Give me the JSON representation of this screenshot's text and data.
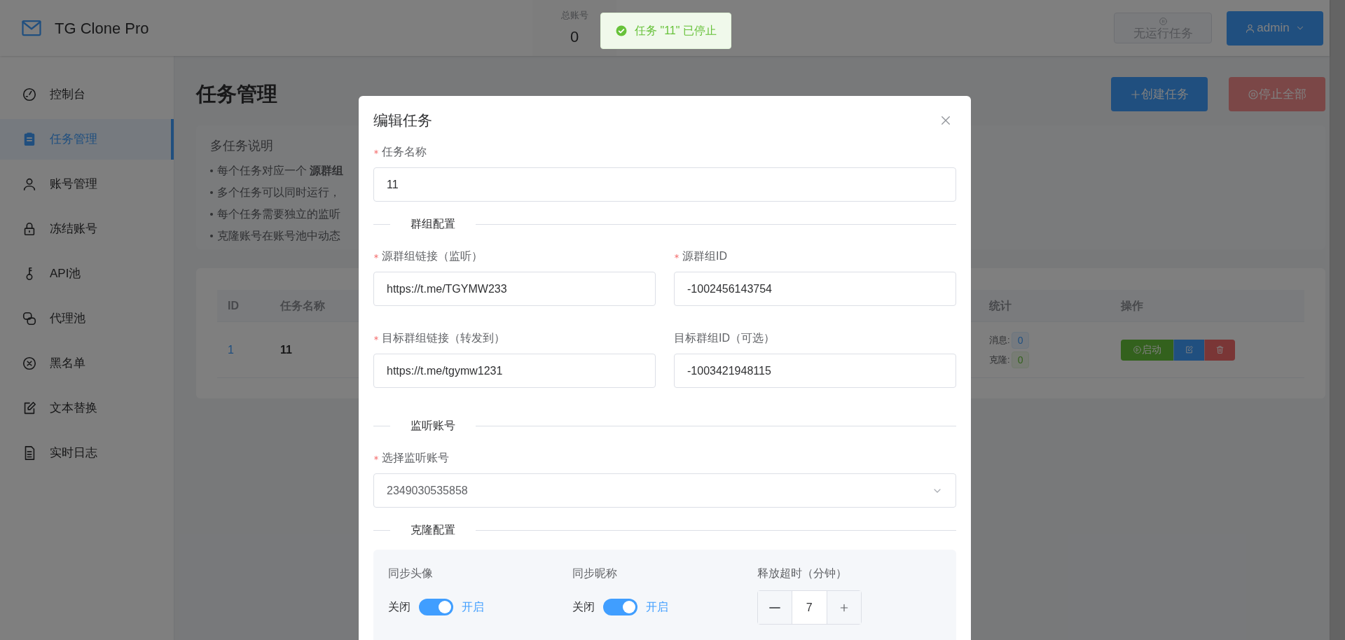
{
  "app": {
    "title": "TG Clone Pro"
  },
  "header_stats": [
    {
      "label": "总账号",
      "value": "0"
    }
  ],
  "toast": {
    "kind": "success",
    "message": "任务 \"11\" 已停止"
  },
  "header_actions": {
    "status_button": "无运行任务",
    "user_menu": "admin"
  },
  "sidebar": {
    "items": [
      {
        "label": "控制台",
        "selected": false
      },
      {
        "label": "任务管理",
        "selected": true
      },
      {
        "label": "账号管理",
        "selected": false
      },
      {
        "label": "冻结账号",
        "selected": false
      },
      {
        "label": "API池",
        "selected": false
      },
      {
        "label": "代理池",
        "selected": false
      },
      {
        "label": "黑名单",
        "selected": false
      },
      {
        "label": "文本替换",
        "selected": false
      },
      {
        "label": "实时日志",
        "selected": false
      }
    ]
  },
  "page": {
    "title": "任务管理",
    "buttons": [
      {
        "label": "创建任务",
        "kind": "create",
        "disabled": false
      },
      {
        "label": "停止全部",
        "kind": "stop",
        "disabled": true
      }
    ]
  },
  "info": {
    "title": "多任务说明",
    "lines": [
      "每个任务对应一个 **源群组**",
      "多个任务可以同时运行，",
      "每个任务需要独立的监听",
      "克隆账号在账号池中动态"
    ]
  },
  "table": {
    "columns": [
      {
        "label": "ID",
        "kind": "id"
      },
      {
        "label": "任务名称",
        "kind": "name"
      },
      {
        "label": "统计",
        "kind": "stats"
      },
      {
        "label": "操作",
        "kind": "actions"
      }
    ],
    "rows": [
      {
        "id": "1",
        "name": "11",
        "stats": [
          {
            "label": "消息:",
            "value": "0",
            "kind": "info"
          },
          {
            "label": "克隆:",
            "value": "0",
            "kind": "success"
          }
        ],
        "actions": [
          {
            "kind": "start",
            "label": "启动"
          },
          {
            "kind": "edit"
          },
          {
            "kind": "delete"
          }
        ]
      }
    ]
  },
  "dialog": {
    "title": "编辑任务",
    "name_field": {
      "label": "任务名称",
      "required": true,
      "value": "11"
    },
    "groups": [
      {
        "title": "群组配置",
        "fields": [
          {
            "kind": "input",
            "label": "源群组链接（监听）",
            "required": true,
            "value": "https://t.me/TGYMW233"
          },
          {
            "kind": "input",
            "label": "源群组ID",
            "required": true,
            "value": "-1002456143754"
          },
          {
            "kind": "input",
            "label": "目标群组链接（转发到）",
            "required": true,
            "value": "https://t.me/tgymw1231"
          },
          {
            "kind": "input",
            "label": "目标群组ID（可选）",
            "required": false,
            "value": "-1003421948115"
          }
        ]
      },
      {
        "title": "监听账号",
        "fields": [
          {
            "kind": "select",
            "label": "选择监听账号",
            "required": true,
            "value": "2349030535858"
          }
        ]
      },
      {
        "title": "克隆配置",
        "settings": [
          {
            "kind": "switch",
            "label": "同步头像",
            "off_label": "关闭",
            "on_label": "开启",
            "on": true
          },
          {
            "kind": "switch",
            "label": "同步昵称",
            "off_label": "关闭",
            "on_label": "开启",
            "on": true
          },
          {
            "kind": "number",
            "label": "释放超时（分钟）",
            "value": "7"
          }
        ]
      }
    ]
  }
}
